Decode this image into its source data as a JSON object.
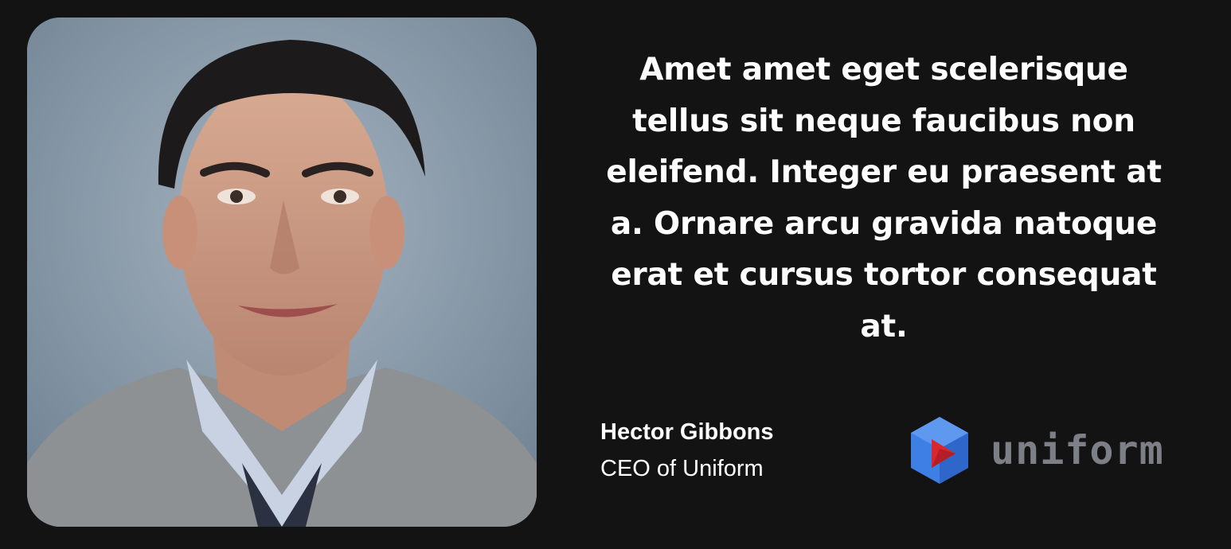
{
  "testimonial": {
    "quote": "Amet amet eget scelerisque tellus sit neque faucibus non eleifend. Integer eu praesent at a. Ornare arcu gravida natoque erat et cursus tortor consequat at.",
    "author": {
      "name": "Hector Gibbons",
      "role": "CEO of Uniform"
    },
    "company_logo": {
      "icon": "uniform-logo-icon",
      "wordmark": "uniform"
    }
  },
  "colors": {
    "background": "#131313",
    "text": "#ffffff",
    "logo_blue": "#3e7fe6",
    "logo_red": "#d9272e",
    "logo_wordmark": "#7d7f86"
  }
}
